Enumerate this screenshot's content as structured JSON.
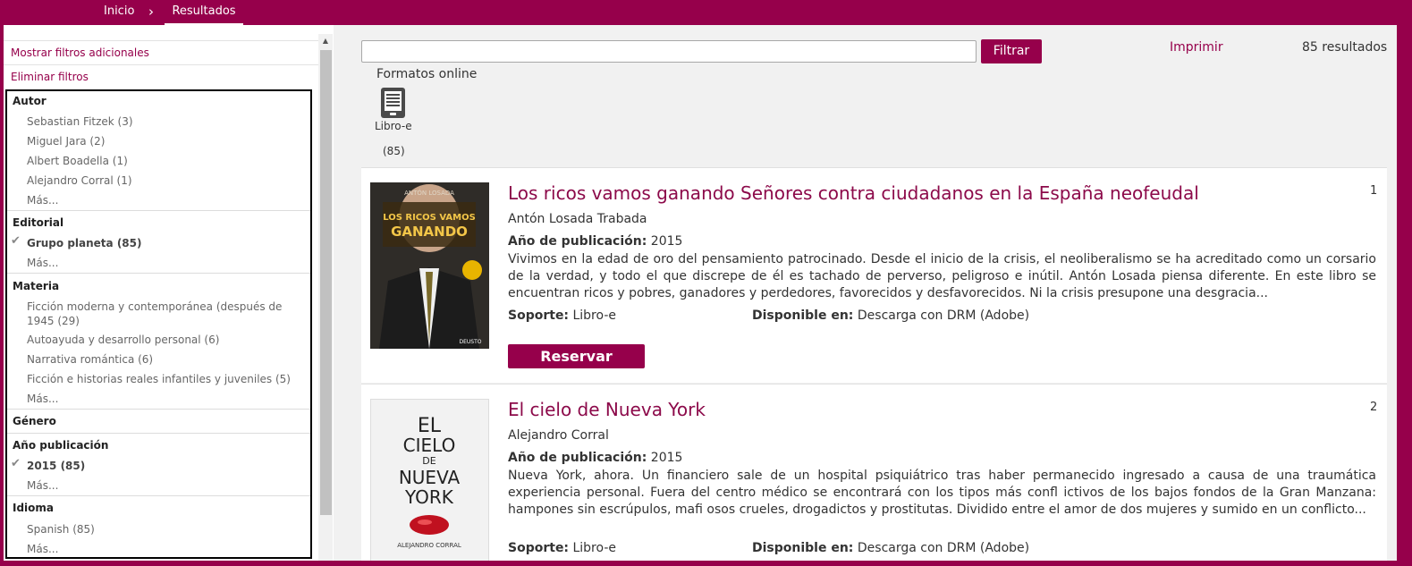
{
  "breadcrumb": {
    "home": "Inicio",
    "separator": "›",
    "current": "Resultados"
  },
  "sidebar": {
    "show_more_filters": "Mostrar filtros adicionales",
    "clear_filters": "Eliminar filtros",
    "facets": [
      {
        "title": "Autor",
        "items": [
          "Sebastian Fitzek (3)",
          "Miguel Jara (2)",
          "Albert Boadella (1)",
          "Alejandro Corral (1)"
        ],
        "more": "Más..."
      },
      {
        "title": "Editorial",
        "selected": "Grupo planeta (85)",
        "more": "Más..."
      },
      {
        "title": "Materia",
        "items": [
          "Ficción moderna y contemporánea (después de 1945 (29)",
          "Autoayuda y desarrollo personal (6)",
          "Narrativa romántica (6)",
          "Ficción e historias reales infantiles y juveniles (5)"
        ],
        "more": "Más..."
      },
      {
        "title": "Género"
      },
      {
        "title": "Año publicación",
        "selected": "2015 (85)",
        "more": "Más..."
      },
      {
        "title": "Idioma",
        "items": [
          "Spanish (85)"
        ],
        "more": "Más..."
      }
    ]
  },
  "search": {
    "value": "",
    "placeholder": "",
    "filter_button": "Filtrar"
  },
  "toolbar": {
    "print": "Imprimir",
    "results_count": "85 resultados"
  },
  "formats": {
    "title": "Formatos online",
    "icon": "ebook-reader-icon",
    "label": "Libro-e",
    "count": "(85)"
  },
  "results": [
    {
      "number": "1",
      "title": "Los ricos vamos ganando Señores contra ciudadanos en la España neofeudal",
      "author": "Antón Losada Trabada",
      "year_label": "Año de publicación:",
      "year": "2015",
      "description": "Vivimos en la edad de oro del pensamiento patrocinado. Desde el inicio de la crisis, el neoliberalismo se ha acreditado como un corsario de la verdad, y todo el que discrepe de él es tachado de perverso, peligroso e inútil. Antón Losada piensa diferente. En este libro se encuentran ricos y pobres, ganadores y perdedores, favorecidos y desfavorecidos. Ni la crisis presupone una desgracia...",
      "support_label": "Soporte:",
      "support": "Libro-e",
      "available_label": "Disponible en:",
      "available": "Descarga con DRM (Adobe)",
      "reserve_button": "Reservar",
      "cover_text": {
        "top": "ANTÓN LOSADA",
        "line1": "LOS RICOS VAMOS",
        "line2": "GANANDO",
        "publisher": "DEUSTO"
      }
    },
    {
      "number": "2",
      "title": "El cielo de Nueva York",
      "author": "Alejandro Corral",
      "year_label": "Año de publicación:",
      "year": "2015",
      "description": "Nueva York, ahora. Un financiero sale de un hospital psiquiátrico tras haber permanecido ingresado a causa de una traumática experiencia personal. Fuera del centro médico se encontrará con los tipos más confl ictivos de los bajos fondos de la Gran Manzana: hampones sin escrúpulos, mafi osos crueles, drogadictos y prostitutas. Dividido entre el amor de dos mujeres y sumido en un conflicto...",
      "support_label": "Soporte:",
      "support": "Libro-e",
      "available_label": "Disponible en:",
      "available": "Descarga con DRM (Adobe)",
      "cover_text": {
        "l1": "EL",
        "l2": "CIELO",
        "l3": "DE",
        "l4": "NUEVA",
        "l5": "YORK",
        "author": "ALEJANDRO CORRAL"
      }
    }
  ],
  "colors": {
    "brand": "#96004b",
    "title": "#8c0a4a"
  }
}
